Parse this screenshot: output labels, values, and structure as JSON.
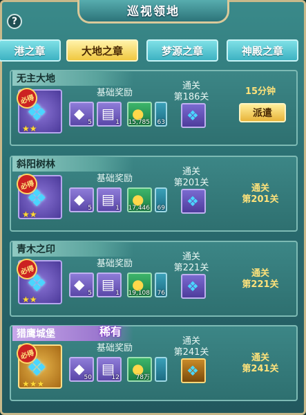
{
  "title": "巡视领地",
  "tabs": [
    {
      "label": "港之章",
      "active": false
    },
    {
      "label": "大地之章",
      "active": true
    },
    {
      "label": "梦源之章",
      "active": false
    },
    {
      "label": "神殿之章",
      "active": false
    }
  ],
  "base_reward_label": "基础奖励",
  "pass_label": "通关",
  "stamp_text": "必得",
  "colors": {
    "accent": "#f0c840",
    "rare": "#9c78cf"
  },
  "territories": [
    {
      "name": "无主大地",
      "rare": false,
      "stars": "★★",
      "rewards": [
        "5",
        "1",
        "15,785",
        "63"
      ],
      "stage": "第186关",
      "timer": "15分钟",
      "dispatch_label": "派遣"
    },
    {
      "name": "斜阳树林",
      "rare": false,
      "stars": "★★",
      "rewards": [
        "5",
        "1",
        "17,446",
        "69"
      ],
      "stage": "第201关",
      "locked_text_1": "通关",
      "locked_text_2": "第201关"
    },
    {
      "name": "青木之印",
      "rare": false,
      "stars": "★★",
      "rewards": [
        "5",
        "1",
        "19,108",
        "76"
      ],
      "stage": "第221关",
      "locked_text_1": "通关",
      "locked_text_2": "第221关"
    },
    {
      "name": "猎鹰城堡",
      "rare": true,
      "rare_label": "稀有",
      "stars": "★★★",
      "rewards": [
        "50",
        "12",
        "78万",
        ""
      ],
      "stage": "第241关",
      "locked_text_1": "通关",
      "locked_text_2": "第241关"
    }
  ]
}
